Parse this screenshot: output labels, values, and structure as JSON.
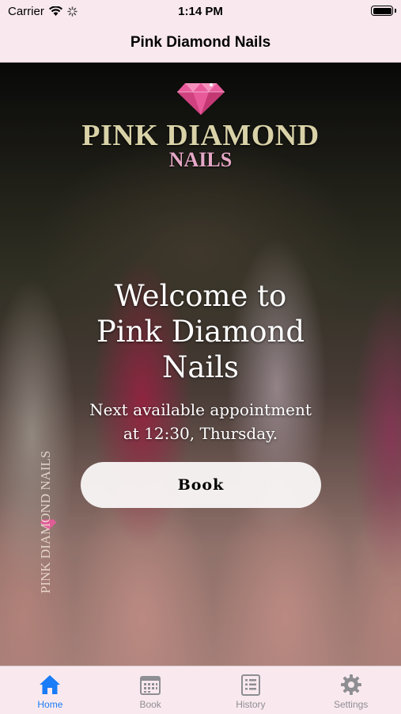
{
  "status_bar": {
    "carrier": "Carrier",
    "time": "1:14 PM"
  },
  "nav": {
    "title": "Pink Diamond Nails"
  },
  "hero": {
    "logo_line1": "PINK DIAMOND",
    "logo_line2": "NAILS",
    "welcome_line1": "Welcome to",
    "welcome_line2": "Pink Diamond",
    "welcome_line3": "Nails",
    "appt_line1": "Next available appointment",
    "appt_line2": "at 12:30, Thursday.",
    "book_label": "Book",
    "watermark_text": "PINK DIAMOND NAILS"
  },
  "tabs": [
    {
      "label": "Home",
      "icon": "house-icon",
      "active": true
    },
    {
      "label": "Book",
      "icon": "calendar-icon",
      "active": false
    },
    {
      "label": "History",
      "icon": "list-icon",
      "active": false
    },
    {
      "label": "Settings",
      "icon": "gear-icon",
      "active": false
    }
  ],
  "colors": {
    "accent": "#1a7cf6",
    "bar_background": "#f9e9ee",
    "inactive_tab": "#8e8e93"
  }
}
